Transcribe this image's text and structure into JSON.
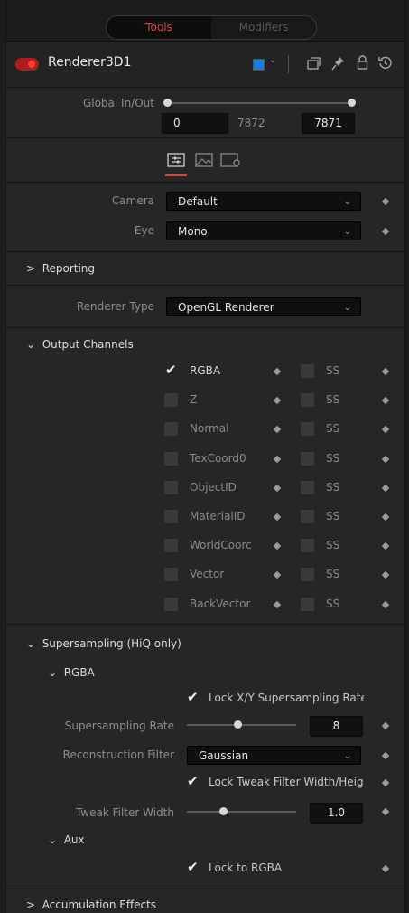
{
  "tabs": {
    "tools": "Tools",
    "modifiers": "Modifiers"
  },
  "node": {
    "name": "Renderer3D1"
  },
  "global_inout": {
    "label": "Global In/Out",
    "in": "0",
    "mid": "7872",
    "out": "7871"
  },
  "camera": {
    "label": "Camera",
    "value": "Default"
  },
  "eye": {
    "label": "Eye",
    "value": "Mono"
  },
  "reporting": {
    "label": "Reporting"
  },
  "renderer_type": {
    "label": "Renderer Type",
    "value": "OpenGL Renderer"
  },
  "output_channels": {
    "label": "Output Channels",
    "ss_label": "SS",
    "channels": [
      {
        "name": "RGBA",
        "checked": true
      },
      {
        "name": "Z",
        "checked": false
      },
      {
        "name": "Normal",
        "checked": false
      },
      {
        "name": "TexCoord0",
        "checked": false
      },
      {
        "name": "ObjectID",
        "checked": false
      },
      {
        "name": "MaterialID",
        "checked": false
      },
      {
        "name": "WorldCoorc",
        "checked": false
      },
      {
        "name": "Vector",
        "checked": false
      },
      {
        "name": "BackVector",
        "checked": false
      }
    ]
  },
  "supersampling": {
    "label": "Supersampling (HiQ only)",
    "rgba_label": "RGBA",
    "lock_xy": "Lock X/Y Supersampling Rate",
    "rate_label": "Supersampling Rate",
    "rate_value": "8",
    "recon_label": "Reconstruction Filter",
    "recon_value": "Gaussian",
    "lock_tweak": "Lock Tweak Filter Width/Height",
    "tweak_label": "Tweak Filter Width",
    "tweak_value": "1.0",
    "aux_label": "Aux",
    "lock_rgba": "Lock to RGBA"
  },
  "accumulation": {
    "label": "Accumulation Effects"
  }
}
